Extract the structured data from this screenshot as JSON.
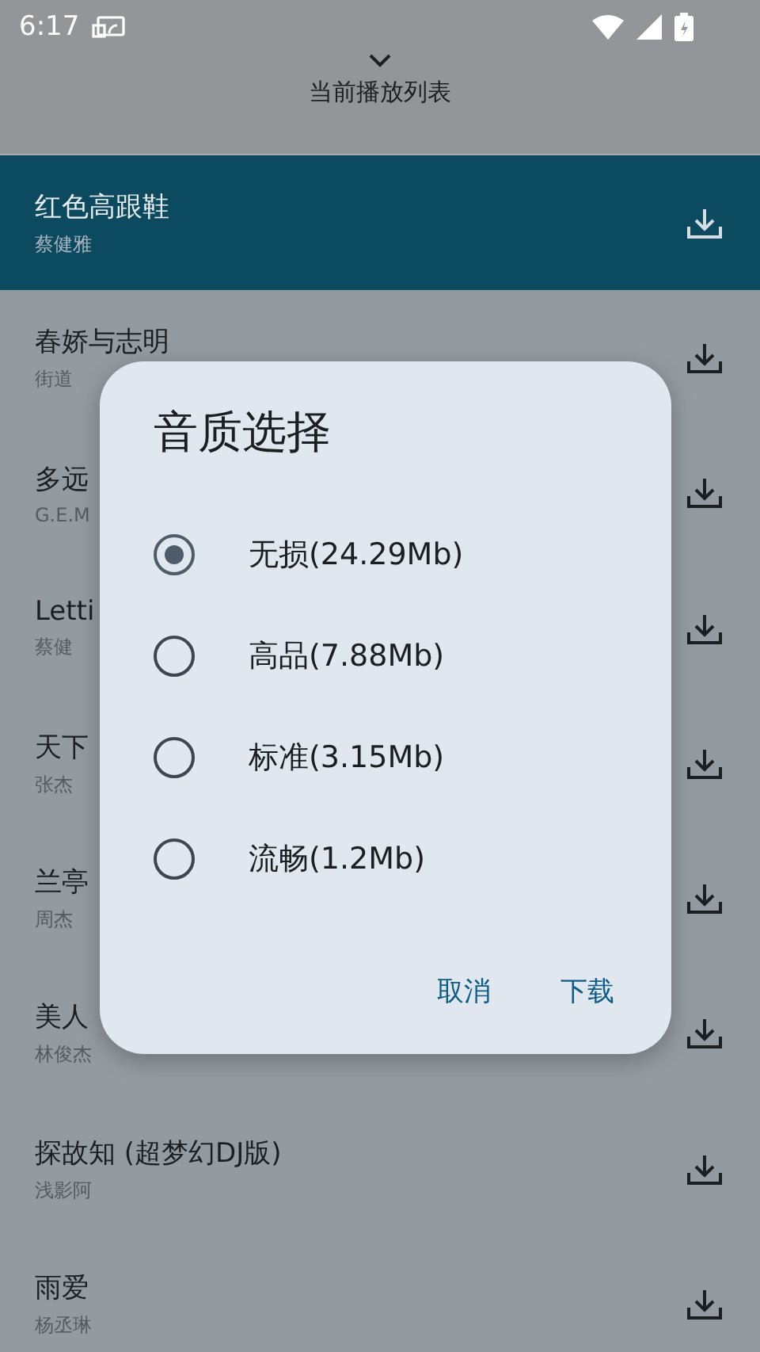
{
  "status_bar": {
    "time": "6:17"
  },
  "header": {
    "title": "当前播放列表"
  },
  "songs": [
    {
      "title": "红色高跟鞋",
      "artist": "蔡健雅",
      "selected": true
    },
    {
      "title": "春娇与志明",
      "artist": "街道",
      "selected": false
    },
    {
      "title": "多远",
      "artist": "G.E.M",
      "selected": false
    },
    {
      "title": "Letti",
      "artist": "蔡健",
      "selected": false
    },
    {
      "title": "天下",
      "artist": "张杰",
      "selected": false
    },
    {
      "title": "兰亭",
      "artist": "周杰",
      "selected": false
    },
    {
      "title": "美人",
      "artist": "林俊杰",
      "selected": false
    },
    {
      "title": "探故知 (超梦幻DJ版)",
      "artist": "浅影阿",
      "selected": false
    },
    {
      "title": "雨爱",
      "artist": "杨丞琳",
      "selected": false
    }
  ],
  "dialog": {
    "title": "音质选择",
    "options": [
      {
        "label": "无损(24.29Mb)",
        "selected": true
      },
      {
        "label": "高品(7.88Mb)",
        "selected": false
      },
      {
        "label": "标准(3.15Mb)",
        "selected": false
      },
      {
        "label": "流畅(1.2Mb)",
        "selected": false
      }
    ],
    "buttons": [
      "取消",
      "下载"
    ]
  }
}
